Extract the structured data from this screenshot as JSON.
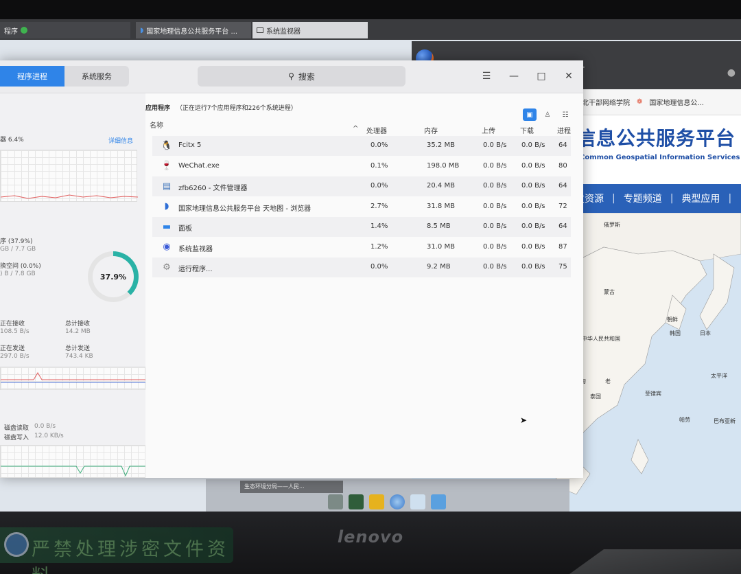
{
  "taskbar_top": {
    "tabs": [
      {
        "label": "程序"
      },
      {
        "label": "国家地理信息公共服务平台 ..."
      },
      {
        "label": "系统监视器"
      }
    ]
  },
  "browser": {
    "bookmarks": [
      "北干部网络学院",
      "国家地理信息公..."
    ],
    "site_title": "信息公共服务平台",
    "site_subtitle": "Common Geospatial Information Services",
    "nav": [
      "发资源",
      "专题频道",
      "典型应用"
    ],
    "nav_sep": "|",
    "map_labels": [
      "俄罗斯",
      "蒙古",
      "中华人民共和国",
      "朝鲜",
      "韩国",
      "日本",
      "缅甸",
      "老",
      "泰国",
      "菲律宾",
      "太平洋",
      "帕劳",
      "巴布亚新"
    ]
  },
  "sysmon": {
    "tabs": [
      "程序进程",
      "系统服务"
    ],
    "active_tab": 0,
    "search_icon": "search-icon",
    "search_label": "搜索",
    "window_controls": [
      "menu-icon",
      "minimize-icon",
      "maximize-icon",
      "close-icon"
    ],
    "glyphs": {
      "menu": "☰",
      "min": "—",
      "max": "□",
      "close": "✕",
      "sort_up": "^"
    },
    "left": {
      "cpu_label": "器 6.4%",
      "details_link": "详细信息",
      "mem_label": "序 (37.9%)",
      "mem_value": "GB / 7.7 GB",
      "swap_label": "换空间 (0.0%)",
      "swap_value": ") B / 7.8 GB",
      "ring_percent": "37.9%",
      "ring_fraction": 0.379,
      "recv_label": "正在接收",
      "recv_value": "108.5 B/s",
      "total_recv_label": "总计接收",
      "total_recv_value": "14.2 MB",
      "send_label": "正在发送",
      "send_value": "297.0 B/s",
      "total_send_label": "总计发送",
      "total_send_value": "743.4 KB",
      "disk_read_label": "磁盘读取",
      "disk_read_value": "0.0 B/s",
      "disk_write_label": "磁盘写入",
      "disk_write_value": "12.0 KB/s"
    },
    "right": {
      "section_title": "应用程序",
      "section_note": "（正在运行7个应用程序和226个系统进程）",
      "view_icons": [
        "app-view-icon",
        "user-view-icon",
        "all-view-icon"
      ],
      "columns": [
        "名称",
        "处理器",
        "内存",
        "上传",
        "下载",
        "进程"
      ],
      "rows": [
        {
          "icon": "fcitx-penguin-icon",
          "name": "Fcitx 5",
          "cpu": "0.0%",
          "mem": "35.2 MB",
          "up": "0.0 B/s",
          "down": "0.0 B/s",
          "pid": "64"
        },
        {
          "icon": "wine-glass-icon",
          "name": "WeChat.exe",
          "cpu": "0.1%",
          "mem": "198.0 MB",
          "up": "0.0 B/s",
          "down": "0.0 B/s",
          "pid": "80"
        },
        {
          "icon": "file-manager-icon",
          "name": "zfb6260 - 文件管理器",
          "cpu": "0.0%",
          "mem": "20.4 MB",
          "up": "0.0 B/s",
          "down": "0.0 B/s",
          "pid": "64"
        },
        {
          "icon": "browser-icon",
          "name": "国家地理信息公共服务平台 天地图 - 浏览器",
          "cpu": "2.7%",
          "mem": "31.8 MB",
          "up": "0.0 B/s",
          "down": "0.0 B/s",
          "pid": "72"
        },
        {
          "icon": "panel-icon",
          "name": "面板",
          "cpu": "1.4%",
          "mem": "8.5 MB",
          "up": "0.0 B/s",
          "down": "0.0 B/s",
          "pid": "64"
        },
        {
          "icon": "system-monitor-icon",
          "name": "系统监视器",
          "cpu": "1.2%",
          "mem": "31.0 MB",
          "up": "0.0 B/s",
          "down": "0.0 B/s",
          "pid": "87"
        },
        {
          "icon": "gear-icon",
          "name": "运行程序...",
          "cpu": "0.0%",
          "mem": "9.2 MB",
          "up": "0.0 B/s",
          "down": "0.0 B/s",
          "pid": "75"
        }
      ]
    }
  },
  "bottom_tab": "生态环境分局——人民...",
  "dock_icons": [
    "file-manager-icon",
    "terminal-icon",
    "notes-icon",
    "browser-icon",
    "search-icon",
    "folder-icon"
  ],
  "monitor": {
    "brand": "lenovo",
    "sticker_text": "严禁处理涉密文件资料"
  },
  "colors": {
    "accent": "#2f84e8",
    "ring": "#2ab2a6",
    "site_blue": "#2a61b8"
  }
}
